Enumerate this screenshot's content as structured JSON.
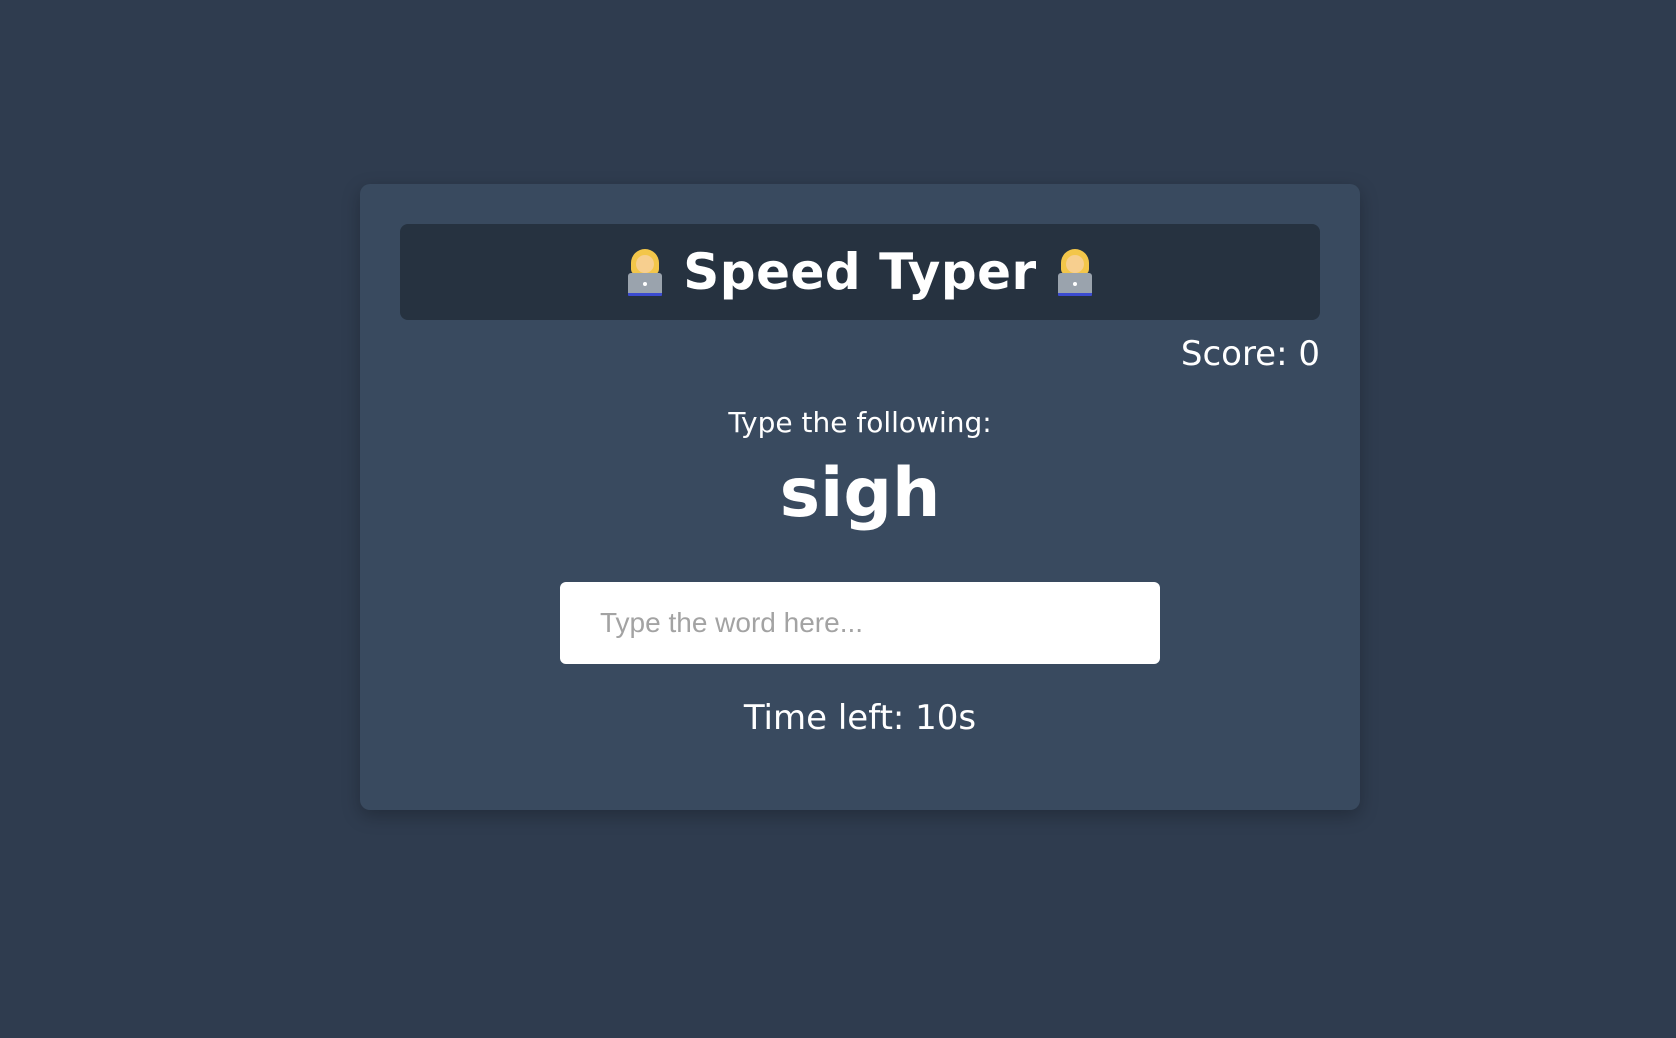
{
  "header": {
    "title": "Speed Typer",
    "left_icon": "woman-technologist-icon",
    "right_icon": "woman-technologist-icon"
  },
  "score": {
    "text": "Score: 0"
  },
  "prompt": {
    "text": "Type the following:"
  },
  "current_word": {
    "text": "sigh"
  },
  "input": {
    "value": "",
    "placeholder": "Type the word here..."
  },
  "timer": {
    "text": "Time left: 10s"
  },
  "colors": {
    "page_background": "#2f3c4f",
    "card_background": "#394a5f",
    "header_background": "#263240",
    "text": "#ffffff"
  }
}
